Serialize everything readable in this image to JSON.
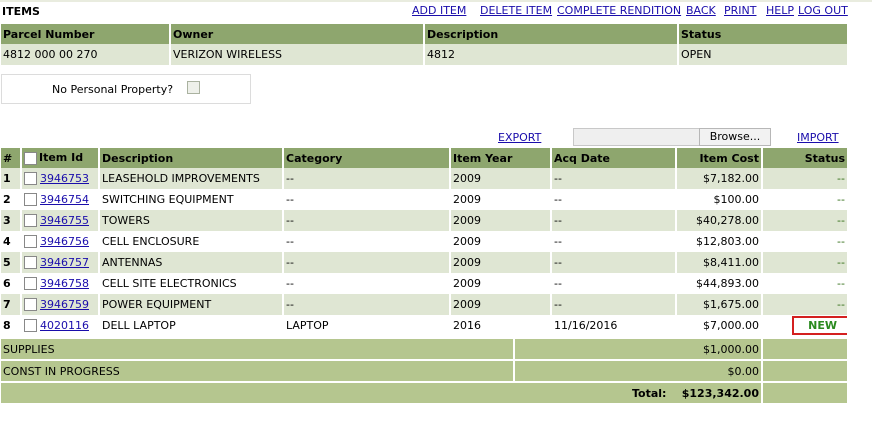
{
  "page": {
    "title": "ITEMS"
  },
  "nav": {
    "add_item": "ADD ITEM",
    "delete_item": "DELETE ITEM",
    "complete_rendition": "COMPLETE RENDITION",
    "back": "BACK",
    "print": "PRINT",
    "help": "HELP",
    "logout": "LOG OUT"
  },
  "parcel": {
    "headers": {
      "parcel_number": "Parcel Number",
      "owner": "Owner",
      "description": "Description",
      "status": "Status"
    },
    "values": {
      "parcel_number": "4812 000 00 270",
      "owner": "VERIZON WIRELESS",
      "description": "4812",
      "status": "OPEN"
    }
  },
  "no_personal_property": {
    "label": "No Personal Property?",
    "checked": false
  },
  "import_export": {
    "export": "EXPORT",
    "browse": "Browse...",
    "import": "IMPORT"
  },
  "items": {
    "headers": {
      "num": "#",
      "item_id": "Item Id",
      "description": "Description",
      "category": "Category",
      "item_year": "Item Year",
      "acq_date": "Acq Date",
      "item_cost": "Item Cost",
      "status": "Status"
    },
    "rows": [
      {
        "num": "1",
        "item_id": "3946753",
        "description": "LEASEHOLD IMPROVEMENTS",
        "category": "--",
        "item_year": "2009",
        "acq_date": "--",
        "item_cost": "$7,182.00",
        "status": "--"
      },
      {
        "num": "2",
        "item_id": "3946754",
        "description": "SWITCHING EQUIPMENT",
        "category": "--",
        "item_year": "2009",
        "acq_date": "--",
        "item_cost": "$100.00",
        "status": "--"
      },
      {
        "num": "3",
        "item_id": "3946755",
        "description": "TOWERS",
        "category": "--",
        "item_year": "2009",
        "acq_date": "--",
        "item_cost": "$40,278.00",
        "status": "--"
      },
      {
        "num": "4",
        "item_id": "3946756",
        "description": "CELL ENCLOSURE",
        "category": "--",
        "item_year": "2009",
        "acq_date": "--",
        "item_cost": "$12,803.00",
        "status": "--"
      },
      {
        "num": "5",
        "item_id": "3946757",
        "description": "ANTENNAS",
        "category": "--",
        "item_year": "2009",
        "acq_date": "--",
        "item_cost": "$8,411.00",
        "status": "--"
      },
      {
        "num": "6",
        "item_id": "3946758",
        "description": "CELL SITE ELECTRONICS",
        "category": "--",
        "item_year": "2009",
        "acq_date": "--",
        "item_cost": "$44,893.00",
        "status": "--"
      },
      {
        "num": "7",
        "item_id": "3946759",
        "description": "POWER EQUIPMENT",
        "category": "--",
        "item_year": "2009",
        "acq_date": "--",
        "item_cost": "$1,675.00",
        "status": "--"
      },
      {
        "num": "8",
        "item_id": "4020116",
        "description": "DELL LAPTOP",
        "category": "LAPTOP",
        "item_year": "2016",
        "acq_date": "11/16/2016",
        "item_cost": "$7,000.00",
        "status": "NEW"
      }
    ]
  },
  "summary": {
    "supplies": {
      "label": "SUPPLIES",
      "value": "$1,000.00"
    },
    "cip": {
      "label": "CONST IN PROGRESS",
      "value": "$0.00"
    },
    "total": {
      "label": "Total:",
      "value": "$123,342.00"
    }
  },
  "colors": {
    "header_bg": "#8ea66e",
    "row_alt_bg": "#dfe6d3",
    "summary_bg": "#b5c68f",
    "link": "#1a0dab",
    "status_new": "#2a8a1e",
    "highlight_border": "#d42020"
  }
}
